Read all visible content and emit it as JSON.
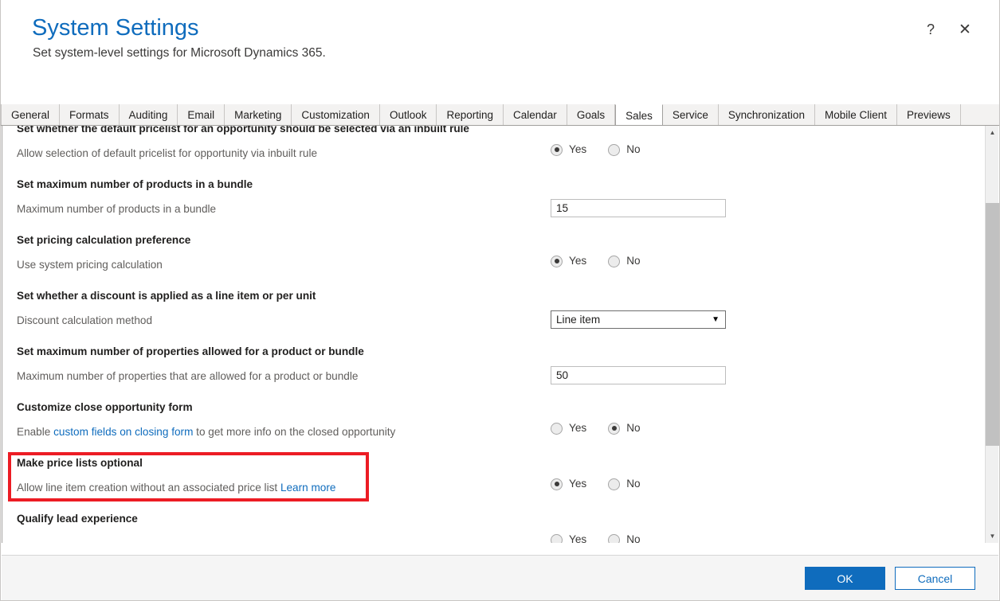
{
  "window": {
    "title": "System Settings",
    "subtitle": "Set system-level settings for Microsoft Dynamics 365.",
    "help_icon": "?",
    "close_icon": "✕"
  },
  "accent_color": "#0f6cbd",
  "highlight_color": "#ec1c24",
  "tabs": [
    {
      "label": "General",
      "active": false
    },
    {
      "label": "Formats",
      "active": false
    },
    {
      "label": "Auditing",
      "active": false
    },
    {
      "label": "Email",
      "active": false
    },
    {
      "label": "Marketing",
      "active": false
    },
    {
      "label": "Customization",
      "active": false
    },
    {
      "label": "Outlook",
      "active": false
    },
    {
      "label": "Reporting",
      "active": false
    },
    {
      "label": "Calendar",
      "active": false
    },
    {
      "label": "Goals",
      "active": false
    },
    {
      "label": "Sales",
      "active": true
    },
    {
      "label": "Service",
      "active": false
    },
    {
      "label": "Synchronization",
      "active": false
    },
    {
      "label": "Mobile Client",
      "active": false
    },
    {
      "label": "Previews",
      "active": false
    }
  ],
  "settings": [
    {
      "heading": "Set whether the default pricelist for an opportunity should be selected via an inbuilt rule",
      "description": "Allow selection of default pricelist for opportunity via inbuilt rule",
      "control": "radio",
      "yes_label": "Yes",
      "no_label": "No",
      "selected": "Yes",
      "clipped_top": true
    },
    {
      "heading": "Set maximum number of products in a bundle",
      "description": "Maximum number of products in a bundle",
      "control": "text",
      "value": "15"
    },
    {
      "heading": "Set pricing calculation preference",
      "description": "Use system pricing calculation",
      "control": "radio",
      "yes_label": "Yes",
      "no_label": "No",
      "selected": "Yes"
    },
    {
      "heading": "Set whether a discount is applied as a line item or per unit",
      "description": "Discount calculation method",
      "control": "select",
      "value": "Line item",
      "arrow": "▼"
    },
    {
      "heading": "Set maximum number of properties allowed for a product or bundle",
      "description": "Maximum number of properties that are allowed for a product or bundle",
      "control": "text",
      "value": "50"
    },
    {
      "heading": "Customize close opportunity form",
      "description_before": "Enable ",
      "description_link": "custom fields on closing form",
      "description_after": " to get more info on the closed opportunity",
      "control": "radio",
      "yes_label": "Yes",
      "no_label": "No",
      "selected": "No"
    },
    {
      "heading": "Make price lists optional",
      "description_before": "Allow line item creation without an associated price list ",
      "description_link": "Learn more",
      "description_after": "",
      "control": "radio",
      "yes_label": "Yes",
      "no_label": "No",
      "selected": "Yes",
      "highlighted": true
    },
    {
      "heading": "Qualify lead experience",
      "description": "",
      "control": "radio",
      "yes_label": "Yes",
      "no_label": "No",
      "selected": "none",
      "clipped_bottom": true
    }
  ],
  "scrollbar": {
    "up_arrow": "▲",
    "down_arrow": "▼"
  },
  "footer": {
    "ok_label": "OK",
    "cancel_label": "Cancel"
  }
}
